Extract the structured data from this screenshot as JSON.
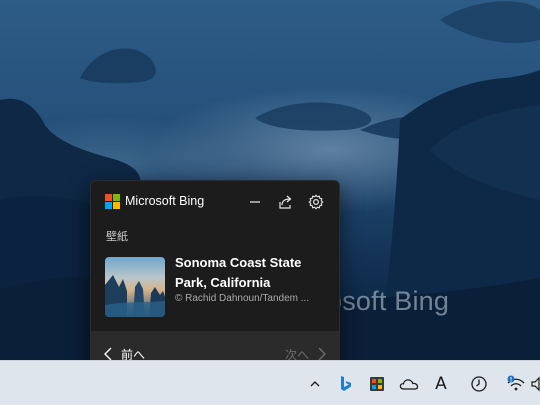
{
  "desktop": {
    "watermark": "osoft Bing"
  },
  "flyout": {
    "brand": "Microsoft Bing",
    "section_label": "壁紙",
    "wallpaper_title": "Sonoma Coast State Park, California",
    "credit": "© Rachid Dahnoun/Tandem ...",
    "prev_label": "前へ",
    "next_label": "次へ",
    "logo_colors": [
      "#f25022",
      "#7fba00",
      "#00a4ef",
      "#ffb900"
    ]
  },
  "taskbar": {
    "input_indicator": "A",
    "tray_icons": [
      "chevron-up-icon",
      "bing-icon",
      "app-icon",
      "onedrive-cloud-icon",
      "ime-icon",
      "clock-icon",
      "wifi-icon",
      "speaker-icon"
    ]
  }
}
